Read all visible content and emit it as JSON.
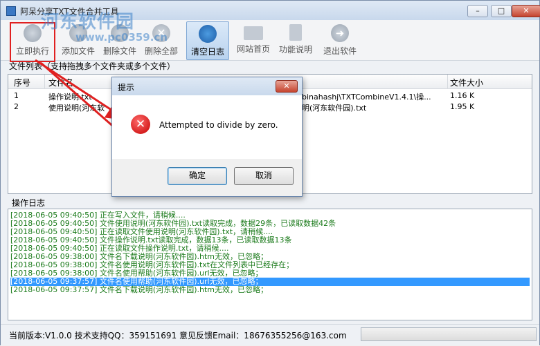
{
  "window": {
    "title": "阿呆分享TXT文件合并工具",
    "controls": [
      "–",
      "□",
      "✕"
    ]
  },
  "watermark": {
    "text": "河东软件园",
    "url": "www.pc0359.cn"
  },
  "toolbar": {
    "items": [
      {
        "label": "立即执行",
        "icon": "play-icon"
      },
      {
        "label": "添加文件",
        "icon": "plus-icon"
      },
      {
        "label": "删除文件",
        "icon": "minus-icon"
      },
      {
        "label": "删除全部",
        "icon": "clear-all-icon"
      },
      {
        "label": "清空日志",
        "icon": "broom-icon"
      },
      {
        "label": "网站首页",
        "icon": "monitor-icon"
      },
      {
        "label": "功能说明",
        "icon": "document-icon"
      },
      {
        "label": "退出软件",
        "icon": "exit-icon"
      }
    ]
  },
  "file_list": {
    "label": "文件列表（支持拖拽多个文件夹或多个文件）",
    "columns": [
      "序号",
      "文件名",
      "文件大小"
    ],
    "rows": [
      {
        "index": "1",
        "name": "操作说明.txt",
        "path": "binahashj\\TXTCombineV1.4.1\\操...",
        "size": "1.16 K"
      },
      {
        "index": "2",
        "name": "使用说明(河东软",
        "path": "明(河东软件园).txt",
        "size": "1.95 K"
      }
    ]
  },
  "log": {
    "label": "操作日志",
    "lines": [
      "[2018-06-05 09:40:50] 正在写入文件，请稍候....",
      "[2018-06-05 09:40:50] 文件使用说明(河东软件园).txt读取完成，数据29条，已读取数据42条",
      "[2018-06-05 09:40:50] 正在读取文件使用说明(河东软件园).txt，请稍候....",
      "[2018-06-05 09:40:50] 文件操作说明.txt读取完成，数据13条，已读取数据13条",
      "[2018-06-05 09:40:50] 正在读取文件操作说明.txt，请稍候....",
      "[2018-06-05 09:38:00] 文件名下载说明(河东软件园).htm无效，已忽略；",
      "[2018-06-05 09:38:00] 文件名使用说明(河东软件园).txt在文件列表中已经存在；",
      "[2018-06-05 09:38:00] 文件名使用帮助(河东软件园).url无效，已忽略；",
      "[2018-06-05 09:37:57] 文件名使用帮助(河东软件园).url无效，已忽略；",
      "[2018-06-05 09:37:57] 文件名下载说明(河东软件园).htm无效，已忽略；"
    ],
    "selected_index": 8
  },
  "status": {
    "text": "当前版本:V1.0.0   技术支持QQ：359151691   意见反馈Email：18676355256@163.com"
  },
  "dialog": {
    "title": "提示",
    "message": "Attempted to divide by zero.",
    "ok_label": "确定",
    "cancel_label": "取消"
  },
  "colors": {
    "log_text": "#1a7a1a",
    "selection": "#3399ff",
    "highlight_box": "#e02020",
    "arrow": "#e02020"
  }
}
